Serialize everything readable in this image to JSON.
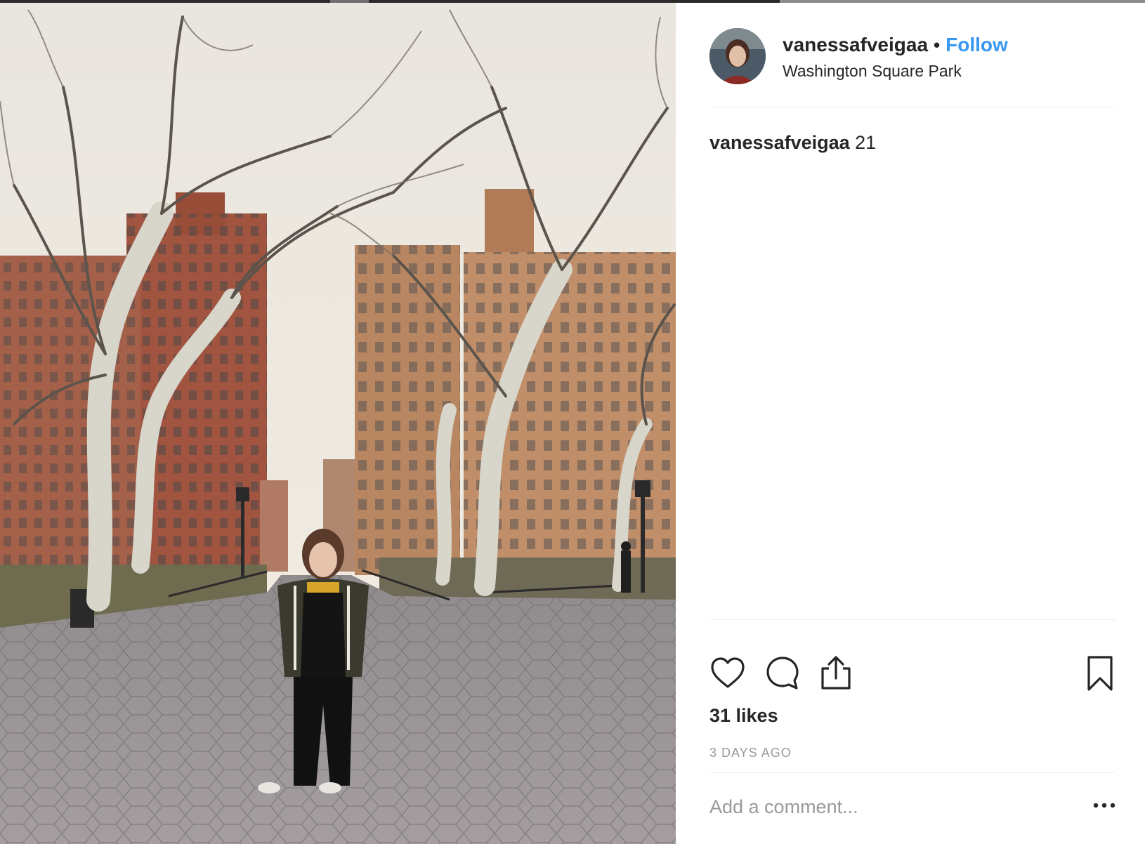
{
  "post": {
    "image_alt": "Person standing in Washington Square Park among bare trees and brick buildings",
    "author": {
      "username": "vanessafveigaa",
      "follow_label": "Follow",
      "separator": "•",
      "location": "Washington Square Park"
    },
    "caption": {
      "username": "vanessafveigaa",
      "text": "21"
    },
    "actions": {
      "like_icon": "heart-icon",
      "comment_icon": "comment-bubble-icon",
      "share_icon": "share-upload-icon",
      "save_icon": "bookmark-icon"
    },
    "likes": "31 likes",
    "timestamp": "3 DAYS AGO",
    "comment": {
      "placeholder": "Add a comment...",
      "more_icon": "more-options-icon"
    }
  },
  "colors": {
    "link_blue": "#3897f0",
    "text": "#262626",
    "muted": "#999999",
    "divider": "#efefef"
  }
}
